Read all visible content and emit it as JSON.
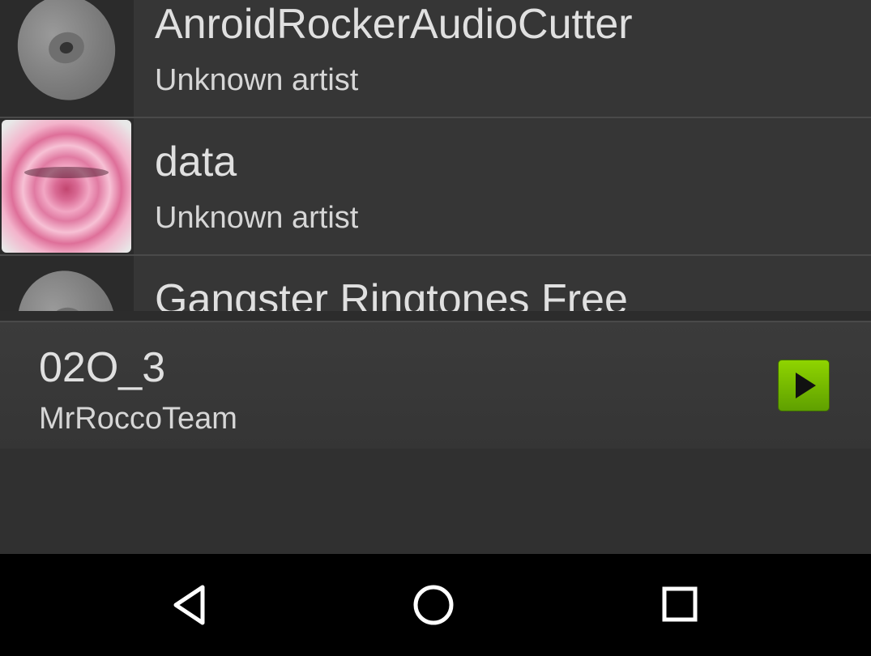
{
  "song_list": {
    "items": [
      {
        "title": "AnroidRockerAudioCutter",
        "artist": "Unknown artist",
        "art": "default-disc-icon"
      },
      {
        "title": "data",
        "artist": "Unknown artist",
        "art": "rose-album-art"
      },
      {
        "title": "Gangster Ringtones Free",
        "artist": "",
        "art": "default-disc-icon"
      }
    ]
  },
  "now_playing": {
    "title": "02O_3",
    "artist": "MrRoccoTeam",
    "play_icon": "play-icon"
  },
  "nav_bar": {
    "back_icon": "back-triangle-icon",
    "home_icon": "home-circle-icon",
    "recents_icon": "recents-square-icon"
  },
  "colors": {
    "background": "#303030",
    "list_bg": "#363636",
    "play_button": "#7bc000",
    "nav_bar": "#000000",
    "text": "#e0e0e0"
  }
}
